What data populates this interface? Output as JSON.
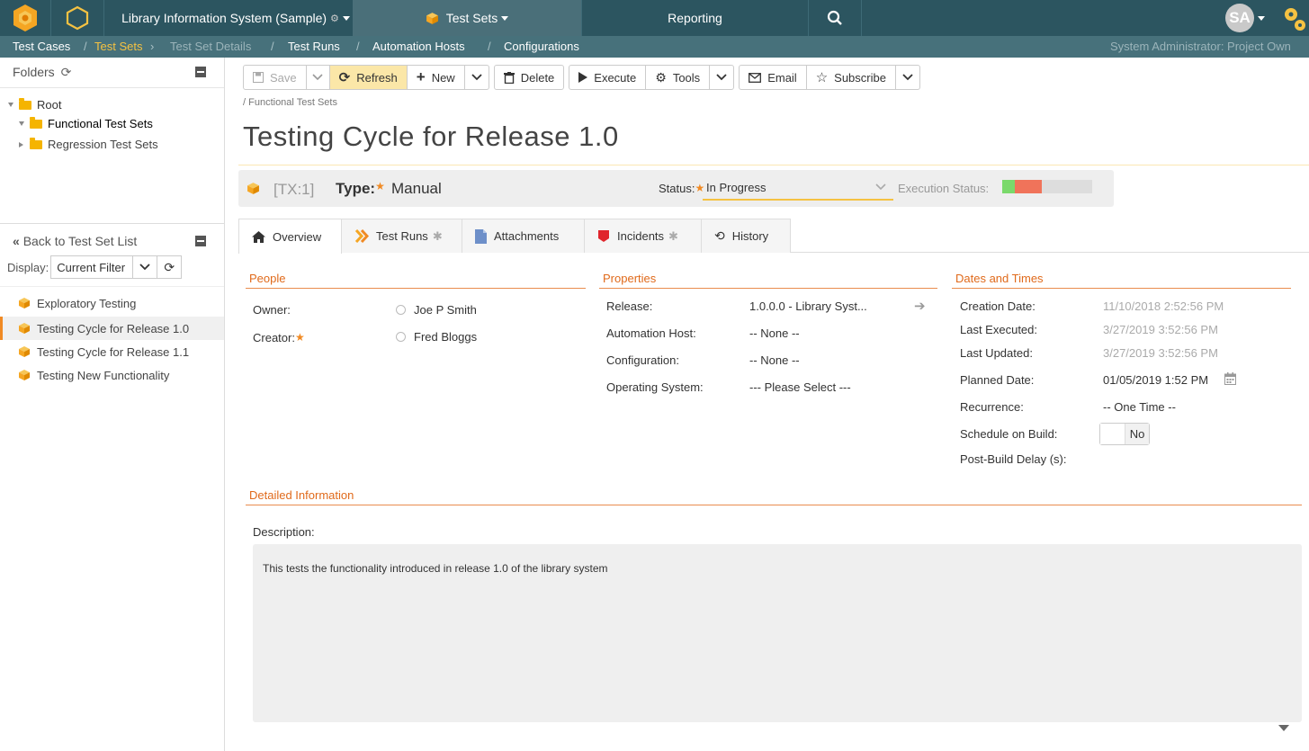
{
  "colors": {
    "navbar": "#2c5560",
    "breadcrumb_bar": "#47717b",
    "accent_orange": "#e06a1b",
    "active_yellow": "#f5c242",
    "refresh_active": "#fbe7a8"
  },
  "navbar": {
    "project_name": "Library Information System (Sample)",
    "artifact_menu": "Test Sets",
    "reporting": "Reporting",
    "avatar_initials": "SA",
    "icons": [
      "spira-logo-icon",
      "hexagon-icon",
      "gear-icon",
      "search-icon",
      "cogs-icon"
    ]
  },
  "breadcrumbs": {
    "items": [
      "Test Cases",
      "Test Sets",
      "Test Set Details",
      "Test Runs",
      "Automation Hosts",
      "Configurations"
    ],
    "user_info": "System Administrator: Project Own"
  },
  "folders": {
    "title": "Folders",
    "tree": [
      {
        "label": "Root"
      },
      {
        "label": "Functional Test Sets"
      },
      {
        "label": "Regression Test Sets"
      }
    ]
  },
  "list_panel": {
    "back_label": "Back to Test Set List",
    "display_label": "Display:",
    "filter_value": "Current Filter",
    "items": [
      {
        "label": "Exploratory Testing"
      },
      {
        "label": "Testing Cycle for Release 1.0"
      },
      {
        "label": "Testing Cycle for Release 1.1"
      },
      {
        "label": "Testing New Functionality"
      }
    ]
  },
  "toolbar": {
    "save": "Save",
    "refresh": "Refresh",
    "new": "New",
    "delete": "Delete",
    "execute": "Execute",
    "tools": "Tools",
    "email": "Email",
    "subscribe": "Subscribe"
  },
  "page": {
    "path": "/ Functional Test Sets",
    "title": "Testing Cycle for Release 1.0"
  },
  "info": {
    "token": "[TX:1]",
    "type_label": "Type:",
    "type_value": "Manual",
    "status_label": "Status:",
    "status_value": "In Progress",
    "execution_label": "Execution Status:",
    "execution_passed_fraction": 0.14,
    "execution_failed_fraction": 0.3
  },
  "tabs": [
    {
      "label": "Overview"
    },
    {
      "label": "Test Runs"
    },
    {
      "label": "Attachments"
    },
    {
      "label": "Incidents"
    },
    {
      "label": "History"
    }
  ],
  "people": {
    "title": "People",
    "owner_label": "Owner:",
    "owner_value": "Joe P Smith",
    "creator_label": "Creator:",
    "creator_value": "Fred Bloggs"
  },
  "properties": {
    "title": "Properties",
    "release_label": "Release:",
    "release_value": "1.0.0.0 - Library Syst...",
    "automation_host_label": "Automation Host:",
    "automation_host_value": "-- None --",
    "configuration_label": "Configuration:",
    "configuration_value": "-- None --",
    "os_label": "Operating System:",
    "os_value": "--- Please Select ---"
  },
  "dates": {
    "title": "Dates and Times",
    "creation_label": "Creation Date:",
    "creation_value": "11/10/2018 2:52:56 PM",
    "executed_label": "Last Executed:",
    "executed_value": "3/27/2019 3:52:56 PM",
    "updated_label": "Last Updated:",
    "updated_value": "3/27/2019 3:52:56 PM",
    "planned_label": "Planned Date:",
    "planned_value": "01/05/2019 1:52 PM",
    "recurrence_label": "Recurrence:",
    "recurrence_value": "-- One Time --",
    "schedule_label": "Schedule on Build:",
    "schedule_value": "No",
    "delay_label": "Post-Build Delay (s):"
  },
  "detail": {
    "title": "Detailed Information",
    "description_label": "Description:",
    "description_text": "This tests the functionality introduced in release 1.0 of the library system"
  }
}
